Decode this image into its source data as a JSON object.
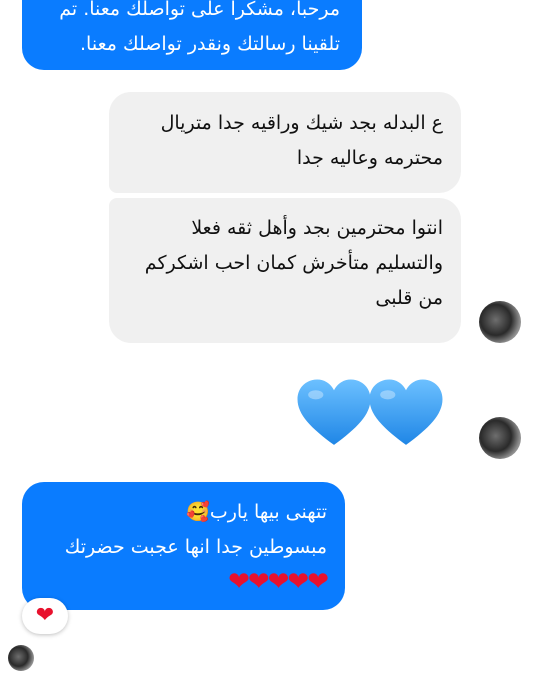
{
  "messages": [
    {
      "lines": [
        "مرحبا، مشكرا على تواصلك معنا. تم",
        "تلقينا رسالتك ونقدر تواصلك معنا."
      ]
    },
    {
      "lines": [
        "ع البدله بجد شيك وراقيه جدا متريال",
        "محترمه وعاليه جدا"
      ]
    },
    {
      "lines": [
        "انتوا محترمين بجد وأهل ثقه فعلا",
        "والتسليم متأخرش كمان احب اشكركم",
        "من قلبى"
      ]
    },
    {
      "big_hearts": [
        "blue-heart",
        "blue-heart"
      ]
    },
    {
      "lines": [
        "تتهنى بيها يارب🥰",
        "مبسوطين جدا انها عجبت حضرتك",
        "❤❤❤❤❤"
      ]
    }
  ],
  "reaction": {
    "emoji": "❤"
  },
  "colors": {
    "sent_bubble": "#0a7cff",
    "received_bubble": "#f0f0f0",
    "heart_blue": "#4aa8f5",
    "heart_red": "#e8112d"
  }
}
